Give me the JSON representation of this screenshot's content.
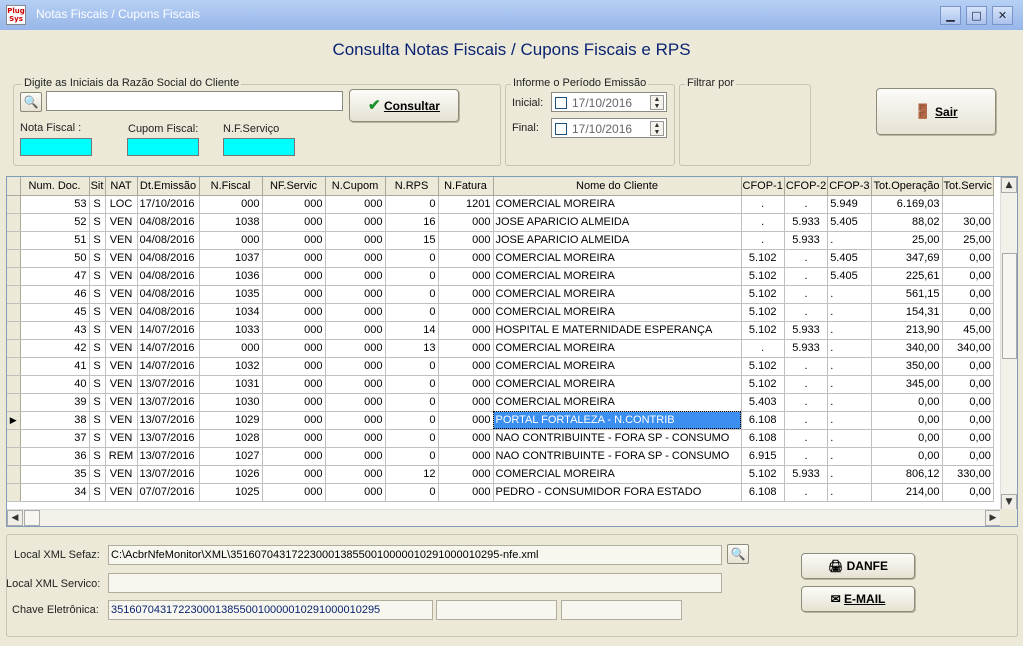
{
  "window": {
    "title": "Notas Fiscais / Cupons Fiscais",
    "app_icon_text": "Plug Sys",
    "minimize": "▁",
    "maximize": "□",
    "close": "✕"
  },
  "heading": "Consulta Notas Fiscais / Cupons Fiscais e RPS",
  "search": {
    "group_label": "Digite as Iniciais da Razão Social do Cliente",
    "value": "",
    "consultar_label": "Consultar",
    "nota_fiscal_label": "Nota Fiscal :",
    "cupom_fiscal_label": "Cupom Fiscal:",
    "nf_servico_label": "N.F.Serviço"
  },
  "period": {
    "group_label": "Informe o Período Emissão",
    "inicial_label": "Inicial:",
    "inicial_value": "17/10/2016",
    "final_label": "Final:",
    "final_value": "17/10/2016"
  },
  "filter": {
    "group_label": "Filtrar por"
  },
  "sair_label": "Sair",
  "table": {
    "columns": [
      "Num. Doc.",
      "Sit",
      "NAT",
      "Dt.Emissão",
      "N.Fiscal",
      "NF.Servic",
      "N.Cupom",
      "N.RPS",
      "N.Fatura",
      "Nome do Cliente",
      "CFOP-1",
      "CFOP-2",
      "CFOP-3",
      "Tot.Operação",
      "Tot.Servic"
    ],
    "rows": [
      [
        "53",
        "S",
        "LOC",
        "17/10/2016",
        "000",
        "000",
        "000",
        "0",
        "1201",
        "COMERCIAL MOREIRA",
        ".",
        ".",
        "5.949",
        "6.169,03",
        ""
      ],
      [
        "52",
        "S",
        "VEN",
        "04/08/2016",
        "1038",
        "000",
        "000",
        "16",
        "000",
        "JOSE APARICIO ALMEIDA",
        ".",
        "5.933",
        "5.405",
        "88,02",
        "30,00"
      ],
      [
        "51",
        "S",
        "VEN",
        "04/08/2016",
        "000",
        "000",
        "000",
        "15",
        "000",
        "JOSE APARICIO ALMEIDA",
        ".",
        "5.933",
        ".",
        "25,00",
        "25,00"
      ],
      [
        "50",
        "S",
        "VEN",
        "04/08/2016",
        "1037",
        "000",
        "000",
        "0",
        "000",
        "COMERCIAL MOREIRA",
        "5.102",
        ".",
        "5.405",
        "347,69",
        "0,00"
      ],
      [
        "47",
        "S",
        "VEN",
        "04/08/2016",
        "1036",
        "000",
        "000",
        "0",
        "000",
        "COMERCIAL MOREIRA",
        "5.102",
        ".",
        "5.405",
        "225,61",
        "0,00"
      ],
      [
        "46",
        "S",
        "VEN",
        "04/08/2016",
        "1035",
        "000",
        "000",
        "0",
        "000",
        "COMERCIAL MOREIRA",
        "5.102",
        ".",
        ".",
        "561,15",
        "0,00"
      ],
      [
        "45",
        "S",
        "VEN",
        "04/08/2016",
        "1034",
        "000",
        "000",
        "0",
        "000",
        "COMERCIAL MOREIRA",
        "5.102",
        ".",
        ".",
        "154,31",
        "0,00"
      ],
      [
        "43",
        "S",
        "VEN",
        "14/07/2016",
        "1033",
        "000",
        "000",
        "14",
        "000",
        "HOSPITAL E MATERNIDADE ESPERANÇA",
        "5.102",
        "5.933",
        ".",
        "213,90",
        "45,00"
      ],
      [
        "42",
        "S",
        "VEN",
        "14/07/2016",
        "000",
        "000",
        "000",
        "13",
        "000",
        "COMERCIAL MOREIRA",
        ".",
        "5.933",
        ".",
        "340,00",
        "340,00"
      ],
      [
        "41",
        "S",
        "VEN",
        "14/07/2016",
        "1032",
        "000",
        "000",
        "0",
        "000",
        "COMERCIAL MOREIRA",
        "5.102",
        ".",
        ".",
        "350,00",
        "0,00"
      ],
      [
        "40",
        "S",
        "VEN",
        "13/07/2016",
        "1031",
        "000",
        "000",
        "0",
        "000",
        "COMERCIAL MOREIRA",
        "5.102",
        ".",
        ".",
        "345,00",
        "0,00"
      ],
      [
        "39",
        "S",
        "VEN",
        "13/07/2016",
        "1030",
        "000",
        "000",
        "0",
        "000",
        "COMERCIAL MOREIRA",
        "5.403",
        ".",
        ".",
        "0,00",
        "0,00"
      ],
      [
        "38",
        "S",
        "VEN",
        "13/07/2016",
        "1029",
        "000",
        "000",
        "0",
        "000",
        "PORTAL FORTALEZA - N.CONTRIB",
        "6.108",
        ".",
        ".",
        "0,00",
        "0,00"
      ],
      [
        "37",
        "S",
        "VEN",
        "13/07/2016",
        "1028",
        "000",
        "000",
        "0",
        "000",
        "NAO CONTRIBUINTE - FORA SP - CONSUMO",
        "6.108",
        ".",
        ".",
        "0,00",
        "0,00"
      ],
      [
        "36",
        "S",
        "REM",
        "13/07/2016",
        "1027",
        "000",
        "000",
        "0",
        "000",
        "NAO CONTRIBUINTE - FORA SP - CONSUMO",
        "6.915",
        ".",
        ".",
        "0,00",
        "0,00"
      ],
      [
        "35",
        "S",
        "VEN",
        "13/07/2016",
        "1026",
        "000",
        "000",
        "12",
        "000",
        "COMERCIAL MOREIRA",
        "5.102",
        "5.933",
        ".",
        "806,12",
        "330,00"
      ],
      [
        "34",
        "S",
        "VEN",
        "07/07/2016",
        "1025",
        "000",
        "000",
        "0",
        "000",
        "PEDRO - CONSUMIDOR FORA ESTADO",
        "6.108",
        ".",
        ".",
        "214,00",
        "0,00"
      ]
    ],
    "selected_row": 12,
    "indicator": "▶"
  },
  "details": {
    "local_xml_sefaz_label": "Local XML Sefaz:",
    "local_xml_sefaz_value": "C:\\AcbrNfeMonitor\\XML\\35160704317223000138550010000010291000010295-nfe.xml",
    "local_xml_servico_label": "Local XML Servico:",
    "local_xml_servico_value": "",
    "chave_label": "Chave Eletrônica:",
    "chave_value": "35160704317223000138550010000010291000010295",
    "danfe_label": "DANFE",
    "email_label": "E-MAIL"
  },
  "colors": {
    "accent_heading": "#0a2472",
    "highlight": "#00ffff",
    "selection": "#3b8ff0"
  }
}
